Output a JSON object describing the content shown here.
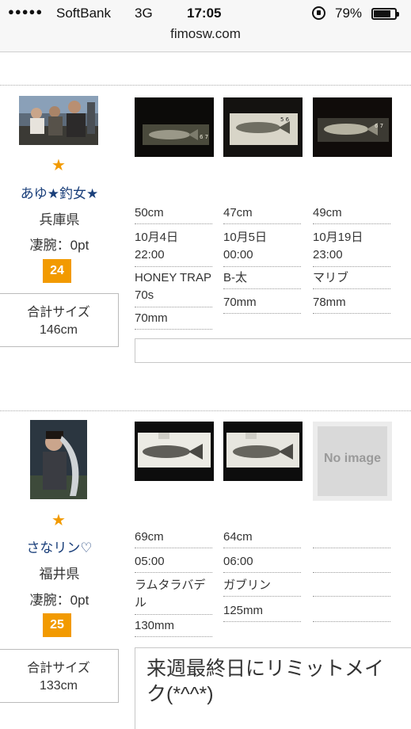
{
  "status_bar": {
    "signal": "●●●●●",
    "carrier": "SoftBank",
    "network": "3G",
    "time": "17:05",
    "battery_percent": "79%",
    "battery_level": 0.79
  },
  "url": "fimosw.com",
  "users": [
    {
      "star": "★",
      "name": "あゆ★釣女★",
      "prefecture": "兵庫県",
      "score": "凄腕：0pt",
      "rank": "24",
      "total_label": "合計サイズ",
      "total_value": "146cm",
      "catches": [
        {
          "size": "50cm",
          "date": "10月4日",
          "time": "22:00",
          "lure": "HONEY TRAP 70s",
          "lure_size": "70mm"
        },
        {
          "size": "47cm",
          "date": "10月5日",
          "time": "00:00",
          "lure": "B-太",
          "lure_size": "70mm"
        },
        {
          "size": "49cm",
          "date": "10月19日",
          "time": "23:00",
          "lure": "マリブ",
          "lure_size": "78mm"
        }
      ],
      "comment": ""
    },
    {
      "star": "★",
      "name": "さなリン♡",
      "prefecture": "福井県",
      "score": "凄腕：0pt",
      "rank": "25",
      "total_label": "合計サイズ",
      "total_value": "133cm",
      "catches": [
        {
          "size": "69cm",
          "time": "05:00",
          "lure": "ラムタラバデル",
          "lure_size": "130mm"
        },
        {
          "size": "64cm",
          "time": "06:00",
          "lure": "ガブリン",
          "lure_size": "125mm"
        }
      ],
      "no_image_label": "No image",
      "comment": "来週最終日にリミットメイク(*^^*)"
    }
  ],
  "colors": {
    "accent": "#f29a00",
    "name": "#1a3f7a"
  }
}
